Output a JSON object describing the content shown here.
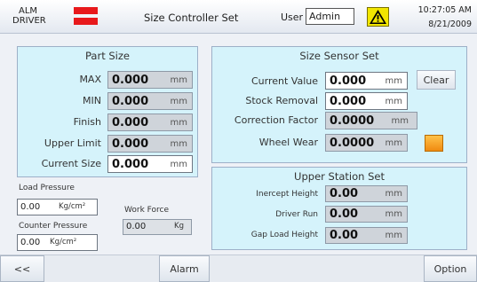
{
  "header": {
    "alarm_line1": "ALM",
    "alarm_line2": "DRIVER",
    "title": "Size Controller Set",
    "user_label": "User",
    "user_value": "Admin",
    "time": "10:27:05 AM",
    "date": "8/21/2009"
  },
  "part_size": {
    "title": "Part Size",
    "rows": [
      {
        "label": "MAX",
        "value": "0.000",
        "unit": "mm"
      },
      {
        "label": "MIN",
        "value": "0.000",
        "unit": "mm"
      },
      {
        "label": "Finish",
        "value": "0.000",
        "unit": "mm"
      },
      {
        "label": "Upper Limit",
        "value": "0.000",
        "unit": "mm"
      },
      {
        "label": "Current Size",
        "value": "0.000",
        "unit": "mm"
      }
    ]
  },
  "pressure": {
    "load_label": "Load Pressure",
    "load_value": "0.00",
    "load_unit": "Kg/cm²",
    "work_force_label": "Work Force",
    "work_force_value": "0.00",
    "work_force_unit": "Kg",
    "counter_label": "Counter Pressure",
    "counter_value": "0.00",
    "counter_unit": "Kg/cm²"
  },
  "size_sensor": {
    "title": "Size Sensor Set",
    "current_value_label": "Current Value",
    "current_value": "0.000",
    "current_value_unit": "mm",
    "clear_label": "Clear",
    "stock_removal_label": "Stock Removal",
    "stock_removal_value": "0.000",
    "stock_removal_unit": "mm",
    "correction_label": "Correction Factor",
    "correction_value": "0.0000",
    "correction_unit": "mm",
    "wheel_wear_label": "Wheel Wear",
    "wheel_wear_value": "0.0000",
    "wheel_wear_unit": "mm"
  },
  "upper_station": {
    "title": "Upper Station Set",
    "rows": [
      {
        "label": "Inercept Height",
        "value": "0.00",
        "unit": "mm"
      },
      {
        "label": "Driver Run",
        "value": "0.00",
        "unit": "mm"
      },
      {
        "label": "Gap Load Height",
        "value": "0.00",
        "unit": "mm"
      }
    ]
  },
  "footer": {
    "back_label": "<<",
    "alarm_label": "Alarm",
    "option_label": "Option"
  },
  "colors": {
    "alarm_red": "#e8191c",
    "panel_bg": "#d5f3fb",
    "warning_yellow": "#f2e600",
    "wheel_button": "#f5a623"
  }
}
